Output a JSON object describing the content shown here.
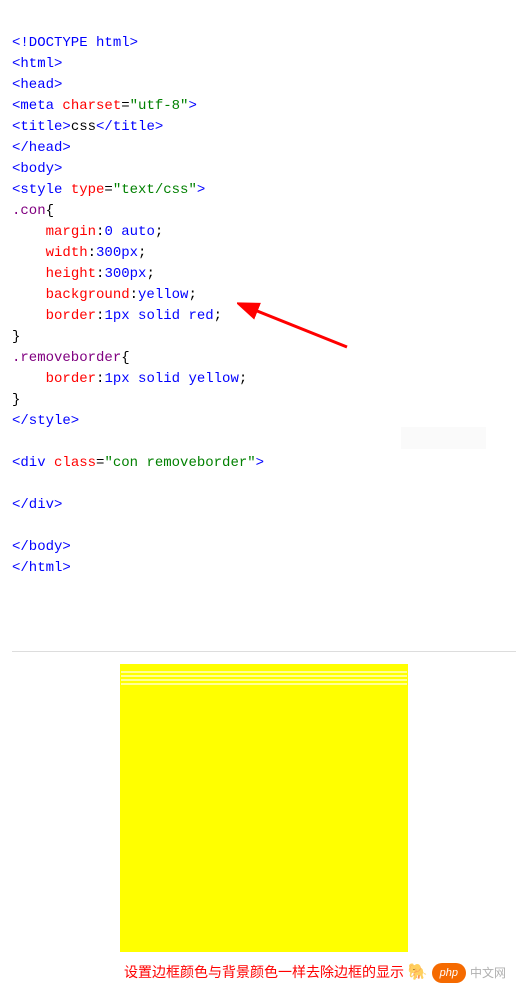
{
  "code": {
    "l1_open": "<!DOCTYPE html",
    "l1_close": ">",
    "l2": "<html>",
    "l3": "<head>",
    "l4a": "<meta ",
    "l4b": "charset",
    "l4c": "=",
    "l4d": "\"utf-8\"",
    "l4e": ">",
    "l5a": "<title>",
    "l5b": "css",
    "l5c": "</title>",
    "l6": "</head>",
    "l7": "<body>",
    "l8a": "<style ",
    "l8b": "type",
    "l8c": "=",
    "l8d": "\"text/css\"",
    "l8e": ">",
    "sel1": ".con",
    "brace_open": "{",
    "p1": "margin",
    "v1": "0 auto",
    "p2": "width",
    "v2": "300px",
    "p3": "height",
    "v3": "300px",
    "p4": "background",
    "v4": "yellow",
    "p5": "border",
    "v5": "1px solid red",
    "brace_close": "}",
    "sel2": ".removeborder",
    "p6": "border",
    "v6": "1px solid yellow",
    "l_style_close": "</style>",
    "l_div_a": "<div ",
    "l_div_b": "class",
    "l_div_c": "=",
    "l_div_d": "\"con removeborder\"",
    "l_div_e": ">",
    "l_div_close": "</div>",
    "l_body_close": "</body>",
    "l_html_close": "</html>",
    "colon": ":",
    "semi": ";"
  },
  "caption": "设置边框颜色与背景颜色一样去除边框的显示",
  "watermark": {
    "badge": "php",
    "cn": "中文网"
  }
}
